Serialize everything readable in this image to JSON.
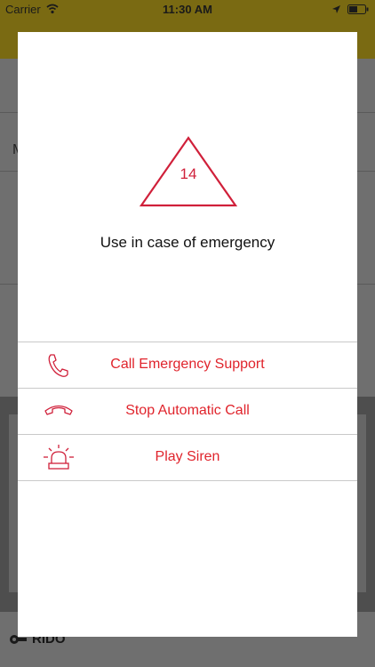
{
  "status_bar": {
    "carrier": "Carrier",
    "time": "11:30 AM",
    "icons": [
      "wifi-icon",
      "location-arrow-icon",
      "battery-icon"
    ]
  },
  "background_app": {
    "header_color": "#f2d21a",
    "partial_letter": "M",
    "footer_logo_text": "RIDO"
  },
  "modal": {
    "countdown": "14",
    "message": "Use in case of emergency",
    "accent_color": "#d0203a",
    "actions": [
      {
        "label": "Call Emergency Support",
        "icon": "phone-icon"
      },
      {
        "label": "Stop Automatic Call",
        "icon": "hang-up-icon"
      },
      {
        "label": "Play Siren",
        "icon": "siren-icon"
      }
    ]
  }
}
